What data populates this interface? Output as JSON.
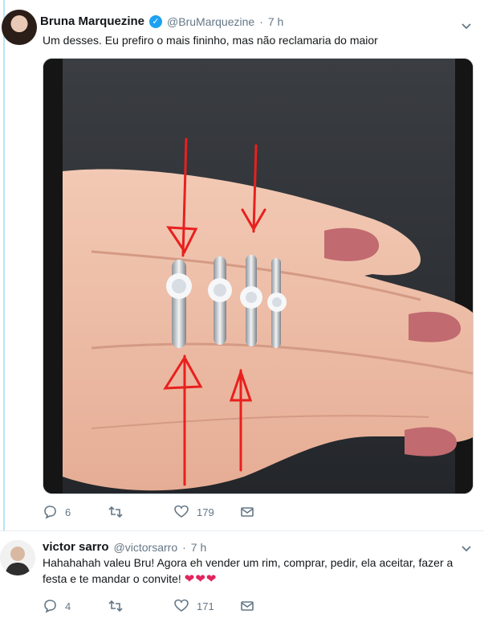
{
  "tweet": {
    "author": "Bruna Marquezine",
    "handle": "@BruMarquezine",
    "separator": "·",
    "time": "7 h",
    "text": "Um desses. Eu prefiro o mais fininho, mas não reclamaria do maior",
    "replies": "6",
    "retweets": "",
    "likes": "179"
  },
  "reply": {
    "author": "victor sarro",
    "handle": "@victorsarro",
    "separator": "·",
    "time": "7 h",
    "text": "Hahahahah valeu Bru! Agora eh vender um rim, comprar, pedir, ela aceitar, fazer a festa e te mandar o convite! ",
    "hearts": "❤❤❤",
    "replies": "4",
    "retweets": "",
    "likes": "171"
  },
  "icons": {
    "reply": "reply-icon",
    "retweet": "retweet-icon",
    "like": "heart-icon",
    "dm": "envelope-icon",
    "verified": "verified-badge-icon",
    "menu": "chevron-down-icon"
  },
  "colors": {
    "thread_line": "#b9e2f7",
    "secondary_text": "#657786",
    "verified_blue": "#1da1f2",
    "heart_red": "#e0245e",
    "annotation_red": "#e8201e"
  }
}
